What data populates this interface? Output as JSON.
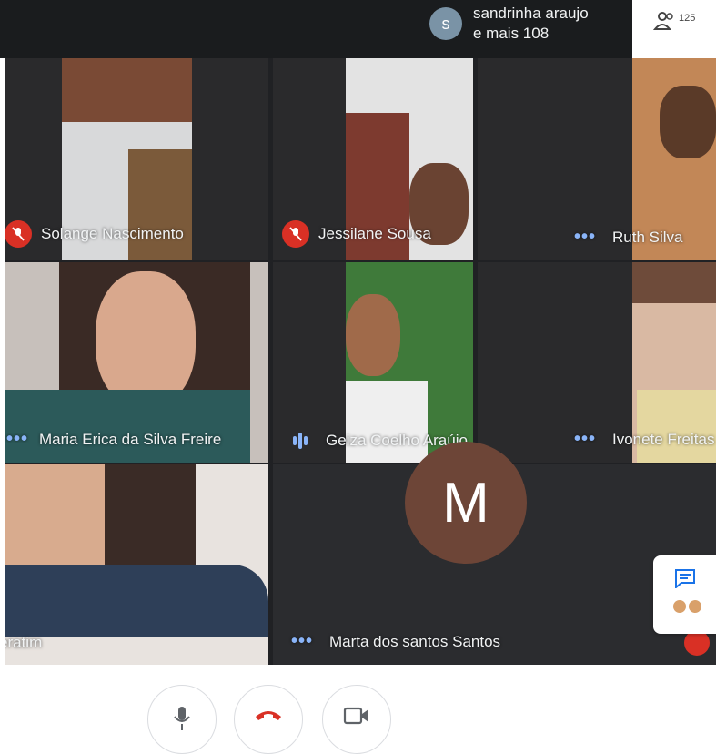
{
  "presenter": {
    "avatar_letter": "s",
    "line1": "sandrinha araujo",
    "line2": "e mais 108"
  },
  "people_count": "125",
  "participants": [
    {
      "name": "Solange Nascimento",
      "status": "muted"
    },
    {
      "name": "Jessilane Sousa",
      "status": "muted"
    },
    {
      "name": "Ruth Silva",
      "status": "dots"
    },
    {
      "name": "Maria Erica da Silva Freire",
      "status": "dots"
    },
    {
      "name": "Geiza Coelho Araújo",
      "status": "speaking"
    },
    {
      "name": "Ivonete Freitas",
      "status": "dots"
    },
    {
      "name": "eratim",
      "status": "none"
    },
    {
      "name": "Marta dos santos Santos",
      "status": "dots",
      "avatar_letter": "M"
    }
  ],
  "colors": {
    "grid_bg": "#202124",
    "muted_red": "#d93025",
    "accent_blue": "#8ab4f8",
    "avatar_brown": "#6d4537"
  }
}
